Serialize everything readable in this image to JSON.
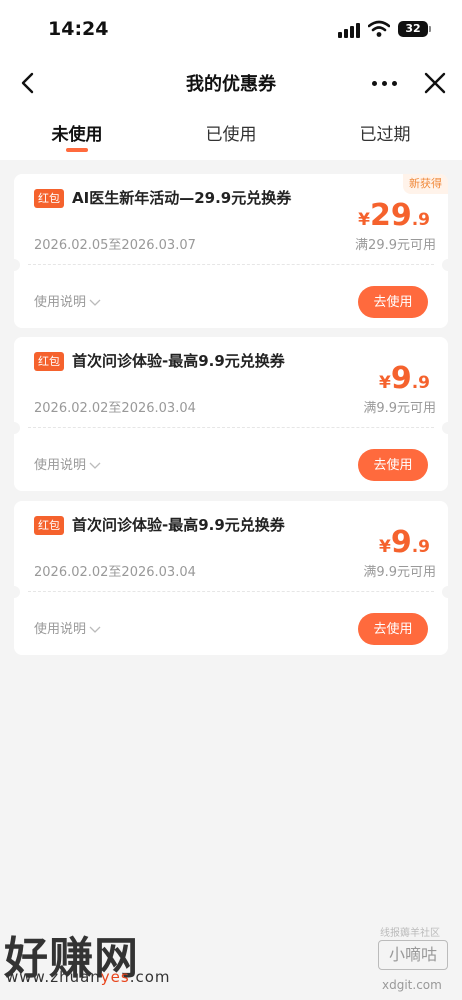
{
  "status_bar": {
    "time": "14:24",
    "battery": "32"
  },
  "header": {
    "title": "我的优惠券",
    "back_icon": "chevron-left-icon",
    "more_icon": "more-dots-icon",
    "close_icon": "close-icon"
  },
  "tabs": [
    {
      "label": "未使用",
      "active": true
    },
    {
      "label": "已使用",
      "active": false
    },
    {
      "label": "已过期",
      "active": false
    }
  ],
  "coupons": [
    {
      "tag": "红包",
      "title": "AI医生新年活动—29.9元兑换券",
      "badge": "新获得",
      "currency": "¥",
      "price_int": "29",
      "price_dec": ".9",
      "validity": "2026.02.05至2026.03.07",
      "threshold": "满29.9元可用",
      "instructions": "使用说明",
      "button": "去使用"
    },
    {
      "tag": "红包",
      "title": "首次问诊体验-最高9.9元兑换券",
      "currency": "¥",
      "price_int": "9",
      "price_dec": ".9",
      "validity": "2026.02.02至2026.03.04",
      "threshold": "满9.9元可用",
      "instructions": "使用说明",
      "button": "去使用"
    },
    {
      "tag": "红包",
      "title": "首次问诊体验-最高9.9元兑换券",
      "currency": "¥",
      "price_int": "9",
      "price_dec": ".9",
      "validity": "2026.02.02至2026.03.04",
      "threshold": "满9.9元可用",
      "instructions": "使用说明",
      "button": "去使用"
    }
  ],
  "watermarks": {
    "logo": "好赚网",
    "url_prefix": "www.zhuan",
    "url_highlight": "yes",
    "url_suffix": ".com",
    "sub": "线报薅羊社区",
    "box": "小嘀咕",
    "domain": "xdgit.com"
  },
  "colors": {
    "accent": "#ff6a3d",
    "price": "#f5622d",
    "background": "#f4f4f4"
  }
}
